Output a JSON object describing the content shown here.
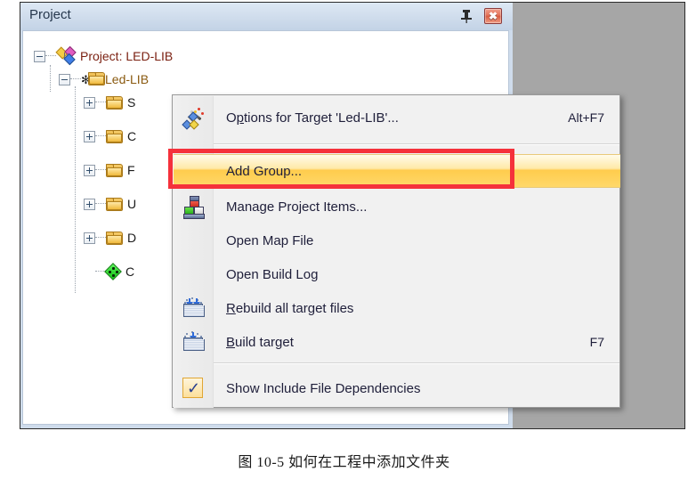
{
  "window": {
    "panel_title": "Project",
    "pin_icon": "pin-icon",
    "close_icon": "close-icon",
    "close_glyph": "✖"
  },
  "tree": {
    "items": [
      {
        "label": "Project: LED-LIB",
        "icon": "project-icon",
        "expander": "minus",
        "level": 0
      },
      {
        "label": "Led-LIB",
        "icon": "target-icon",
        "expander": "minus",
        "level": 1
      },
      {
        "label": "S",
        "icon": "folder-icon",
        "expander": "plus",
        "level": 2
      },
      {
        "label": "C",
        "icon": "folder-icon",
        "expander": "plus",
        "level": 2
      },
      {
        "label": "F",
        "icon": "folder-icon",
        "expander": "plus",
        "level": 2
      },
      {
        "label": "U",
        "icon": "folder-icon",
        "expander": "plus",
        "level": 2
      },
      {
        "label": "D",
        "icon": "folder-icon",
        "expander": "plus",
        "level": 2
      },
      {
        "label": "C",
        "icon": "green-diamond-icon",
        "expander": "none",
        "level": 2
      }
    ]
  },
  "context_menu": {
    "items": [
      {
        "id": "options-for-target",
        "label_pre": "O",
        "label_accel": "p",
        "label_post": "tions for Target 'Led-LIB'...",
        "shortcut": "Alt+F7",
        "icon": "magic-wand-icon",
        "highlighted": false
      },
      {
        "id": "add-group",
        "label_pre": "Add Group...",
        "label_accel": "",
        "label_post": "",
        "shortcut": "",
        "icon": "none",
        "highlighted": true
      },
      {
        "id": "manage-project-items",
        "label_pre": "Manage Project Items...",
        "label_accel": "",
        "label_post": "",
        "shortcut": "",
        "icon": "blocks-icon",
        "highlighted": false
      },
      {
        "id": "open-map-file",
        "label_pre": "Open Map File",
        "label_accel": "",
        "label_post": "",
        "shortcut": "",
        "icon": "none",
        "highlighted": false
      },
      {
        "id": "open-build-log",
        "label_pre": "Open Build Log",
        "label_accel": "",
        "label_post": "",
        "shortcut": "",
        "icon": "none",
        "highlighted": false
      },
      {
        "id": "rebuild-all-target-files",
        "label_pre": "",
        "label_accel": "R",
        "label_post": "ebuild all target files",
        "shortcut": "",
        "icon": "rebuild-icon",
        "highlighted": false
      },
      {
        "id": "build-target",
        "label_pre": "",
        "label_accel": "B",
        "label_post": "uild target",
        "shortcut": "F7",
        "icon": "build-icon",
        "highlighted": false
      },
      {
        "id": "show-include-file-dependencies",
        "label_pre": "Show Include File Dependencies",
        "label_accel": "",
        "label_post": "",
        "shortcut": "",
        "icon": "checkbox-checked-icon",
        "highlighted": false
      }
    ]
  },
  "annotation": {
    "highlight_color": "#f5313b"
  },
  "caption": {
    "text": "图 10-5 如何在工程中添加文件夹"
  }
}
